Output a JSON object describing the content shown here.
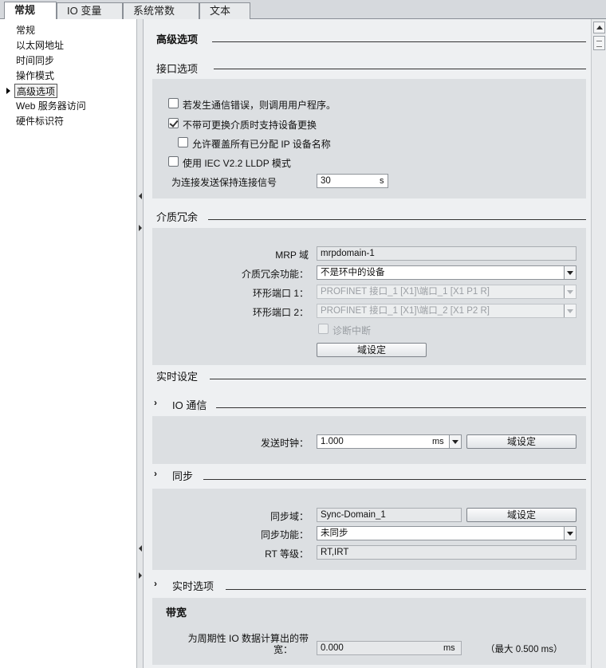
{
  "tabs": [
    {
      "label": "常规"
    },
    {
      "label": "IO 变量"
    },
    {
      "label": "系统常数"
    },
    {
      "label": "文本"
    }
  ],
  "nav": {
    "items": [
      {
        "label": "常规"
      },
      {
        "label": "以太网地址"
      },
      {
        "label": "时间同步"
      },
      {
        "label": "操作模式"
      },
      {
        "label": "高级选项"
      },
      {
        "label": "Web 服务器访问"
      },
      {
        "label": "硬件标识符"
      }
    ],
    "selected": "高级选项"
  },
  "main": {
    "title": "高级选项",
    "interface": {
      "title": "接口选项",
      "cb_comm_error": {
        "label": "若发生通信错误，则调用用户程序。",
        "checked": false
      },
      "cb_device_replace": {
        "label": "不带可更换介质时支持设备更换",
        "checked": true
      },
      "cb_overwrite_names": {
        "label": "允许覆盖所有已分配 IP 设备名称",
        "checked": false
      },
      "cb_lldp": {
        "label": "使用 IEC V2.2 LLDP 模式",
        "checked": false
      },
      "keepalive_label": "为连接发送保持连接信号",
      "keepalive_value": "30",
      "keepalive_unit": "s"
    },
    "media_redundancy": {
      "title": "介质冗余",
      "mrp_domain_label": "MRP 域",
      "mrp_domain_value": "mrpdomain-1",
      "function_label": "介质冗余功能：",
      "function_value": "不是环中的设备",
      "ring_port1_label": "环形端口 1：",
      "ring_port1_value": "PROFINET 接口_1 [X1]\\端口_1 [X1 P1 R]",
      "ring_port2_label": "环形端口 2：",
      "ring_port2_value": "PROFINET 接口_1 [X1]\\端口_2 [X1 P2 R]",
      "diag_interrupt": {
        "label": "诊断中断",
        "checked": false
      },
      "domain_button": "域设定"
    },
    "realtime": {
      "title": "实时设定",
      "io_comm": {
        "title": "IO 通信",
        "send_clock_label": "发送时钟：",
        "send_clock_value": "1.000",
        "send_clock_unit": "ms",
        "domain_button": "域设定"
      },
      "sync": {
        "title": "同步",
        "sync_domain_label": "同步域：",
        "sync_domain_value": "Sync-Domain_1",
        "domain_button": "域设定",
        "sync_function_label": "同步功能：",
        "sync_function_value": "未同步",
        "rt_class_label": "RT 等级：",
        "rt_class_value": "RT,IRT"
      },
      "rt_options": {
        "title": "实时选项",
        "bandwidth_title": "带宽",
        "calc_label_line1": "为周期性 IO 数据计算出的带",
        "calc_label_line2": "宽：",
        "calc_value": "0.000",
        "calc_unit": "ms",
        "max_note": "（最大 0.500 ms）"
      }
    }
  }
}
